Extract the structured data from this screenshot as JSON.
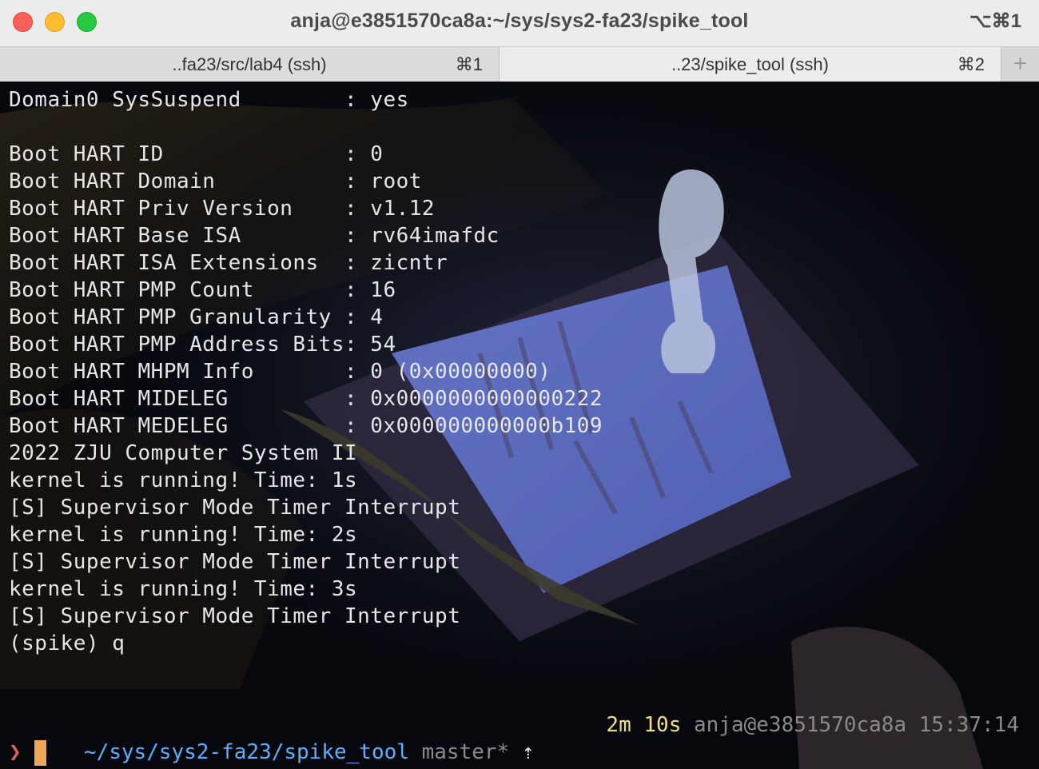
{
  "window": {
    "title": "anja@e3851570ca8a:~/sys/sys2-fa23/spike_tool",
    "shortcut": "⌥⌘1"
  },
  "tabs": [
    {
      "label": "..fa23/src/lab4 (ssh)",
      "key": "⌘1"
    },
    {
      "label": "..23/spike_tool (ssh)",
      "key": "⌘2"
    }
  ],
  "new_tab_label": "+",
  "terminal": {
    "lines": [
      "Domain0 SysSuspend        : yes",
      "",
      "Boot HART ID              : 0",
      "Boot HART Domain          : root",
      "Boot HART Priv Version    : v1.12",
      "Boot HART Base ISA        : rv64imafdc",
      "Boot HART ISA Extensions  : zicntr",
      "Boot HART PMP Count       : 16",
      "Boot HART PMP Granularity : 4",
      "Boot HART PMP Address Bits: 54",
      "Boot HART MHPM Info       : 0 (0x00000000)",
      "Boot HART MIDELEG         : 0x0000000000000222",
      "Boot HART MEDELEG         : 0x000000000000b109",
      "2022 ZJU Computer System II",
      "kernel is running! Time: 1s",
      "[S] Supervisor Mode Timer Interrupt",
      "kernel is running! Time: 2s",
      "[S] Supervisor Mode Timer Interrupt",
      "kernel is running! Time: 3s",
      "[S] Supervisor Mode Timer Interrupt",
      "(spike) q"
    ],
    "prompt": {
      "path": "~/sys/sys2-fa23/spike_tool",
      "branch": "master*",
      "ahead_arrow": "⇡",
      "duration": "2m 10s",
      "host": "anja@e3851570ca8a",
      "time": "15:37:14",
      "symbol": "❯"
    }
  },
  "colors": {
    "path": "#5ab0ff",
    "duration": "#f0e27a",
    "prompt_symbol": "#e0605a",
    "cursor": "#f2a65a"
  }
}
